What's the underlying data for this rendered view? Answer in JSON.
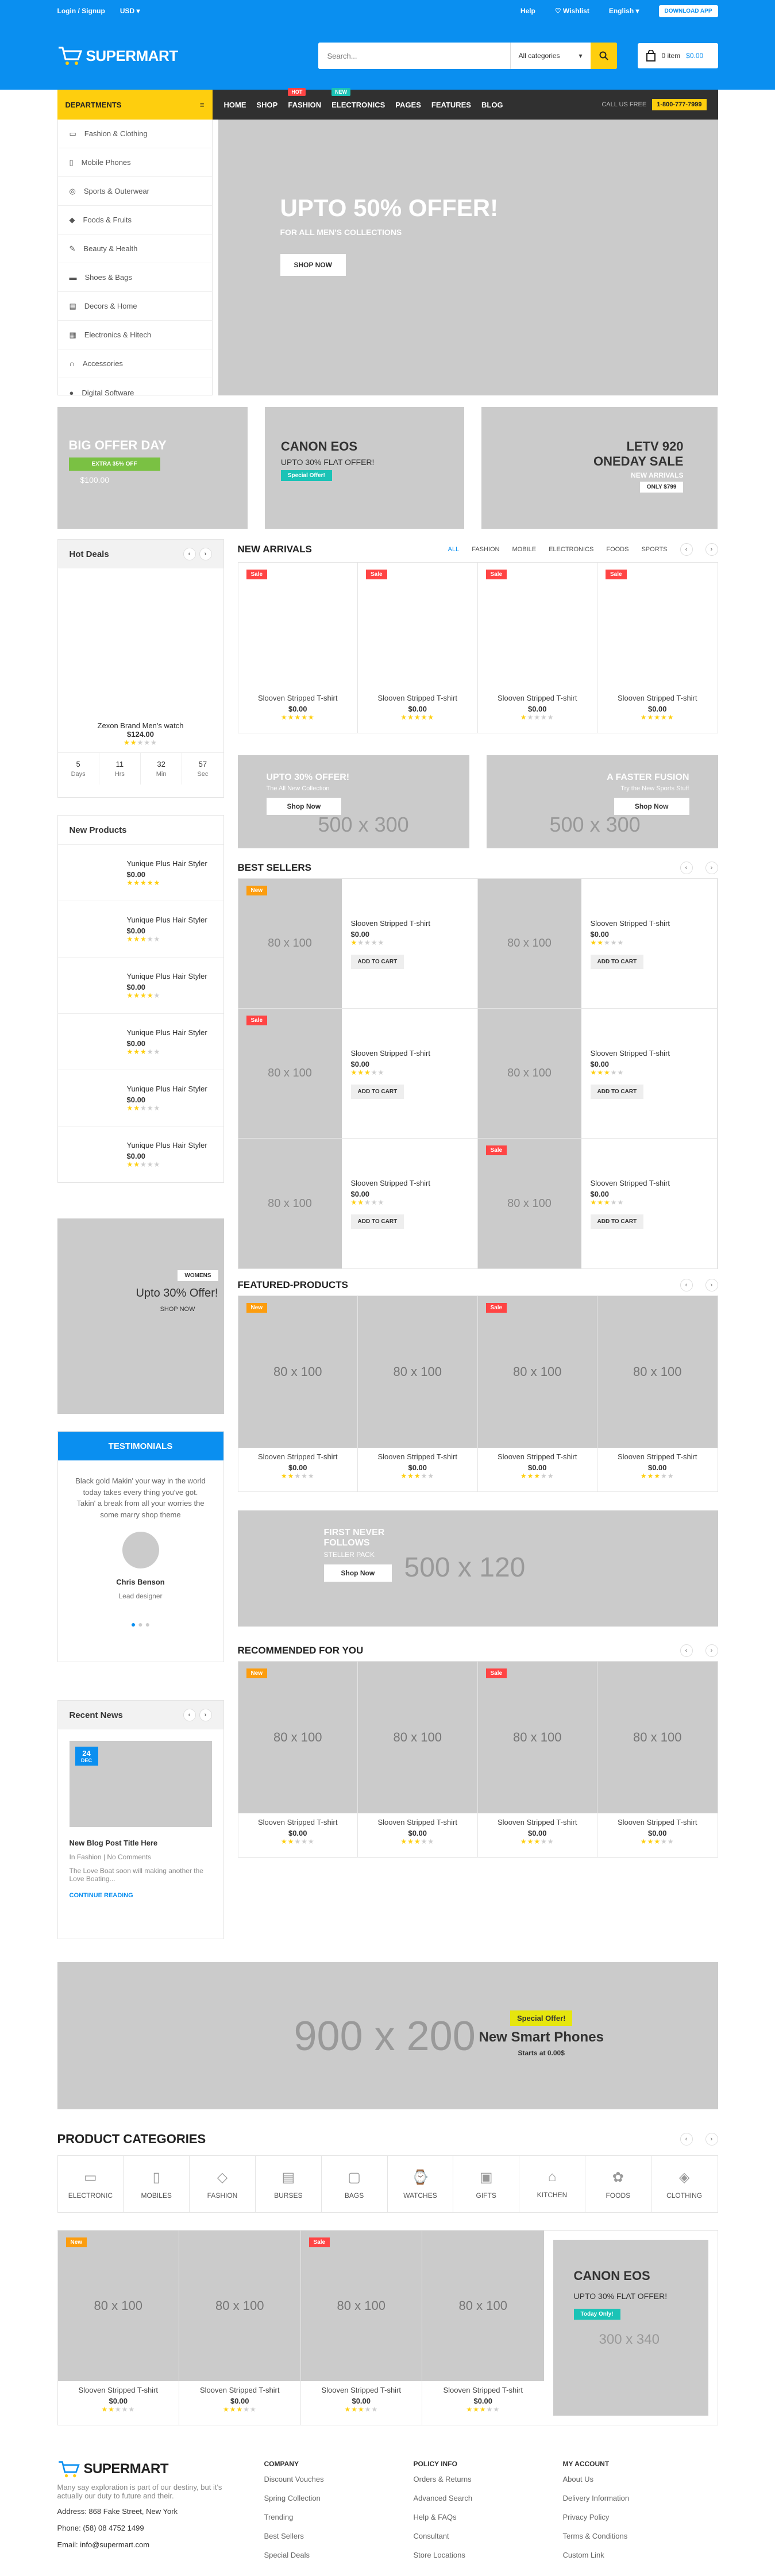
{
  "topbar": {
    "login": "Login / Signup",
    "currency": "USD",
    "help": "Help",
    "wishlist": "Wishlist",
    "language": "English",
    "download": "DOWNLOAD APP"
  },
  "header": {
    "logo": "SUPERMART",
    "search_placeholder": "Search...",
    "category": "All categories",
    "cart_label": "0 item",
    "cart_total": "$0.00"
  },
  "nav": {
    "departments": "DEPARTMENTS",
    "items": [
      "HOME",
      "SHOP",
      "FASHION",
      "ELECTRONICS",
      "PAGES",
      "FEATURES",
      "BLOG"
    ],
    "hot": "HOT",
    "new": "NEW",
    "callus": "CALL US FREE",
    "phone": "1-800-777-7999"
  },
  "sidebar": [
    "Fashion & Clothing",
    "Mobile Phones",
    "Sports & Outerwear",
    "Foods & Fruits",
    "Beauty & Health",
    "Shoes & Bags",
    "Decors & Home",
    "Electronics & Hitech",
    "Accessories",
    "Digital Software"
  ],
  "hero": {
    "title": "UPTO 50% OFFER!",
    "subtitle": "FOR ALL MEN'S COLLECTIONS",
    "button": "SHOP NOW"
  },
  "promos": {
    "p1": {
      "title": "BIG OFFER DAY",
      "tag": "EXTRA 35% OFF",
      "price": "$100.00"
    },
    "p2": {
      "title": "CANON EOS",
      "sub": "UPTO 30% FLAT OFFER!",
      "tag": "Special Offer!"
    },
    "p3": {
      "title": "LETV 920",
      "sub": "ONEDAY SALE",
      "sub2": "NEW ARRIVALS",
      "tag": "ONLY $799"
    }
  },
  "hotdeals": {
    "title": "Hot Deals",
    "name": "Zexon Brand Men's watch",
    "price": "$124.00",
    "counter": [
      {
        "v": "5",
        "l": "Days"
      },
      {
        "v": "11",
        "l": "Hrs"
      },
      {
        "v": "32",
        "l": "Min"
      },
      {
        "v": "57",
        "l": "Sec"
      }
    ]
  },
  "arrivals": {
    "title": "NEW ARRIVALS",
    "tabs": [
      "ALL",
      "FASHION",
      "MOBILE",
      "ELECTRONICS",
      "FOODS",
      "SPORTS"
    ],
    "name": "Slooven Stripped T-shirt",
    "price": "$0.00",
    "sale": "Sale"
  },
  "newproducts": {
    "title": "New Products",
    "name": "Yunique Plus Hair Styler",
    "price": "$0.00"
  },
  "midbanners": {
    "b1": {
      "title": "UPTO 30% OFFER!",
      "sub": "The All New Collection",
      "ph": "500 x 300",
      "button": "Shop Now"
    },
    "b2": {
      "title": "A FASTER FUSION",
      "sub": "Try the New Sports Stuff",
      "ph": "500 x 300",
      "button": "Shop Now"
    }
  },
  "bestsellers": {
    "title": "BEST SELLERS",
    "ph": "80 x 100",
    "name": "Slooven Stripped T-shirt",
    "price": "$0.00",
    "button": "ADD TO CART",
    "new": "New",
    "sale": "Sale"
  },
  "womens": {
    "tag": "WOMENS",
    "title": "Upto 30% Offer!",
    "shop": "SHOP NOW"
  },
  "testimonials": {
    "title": "TESTIMONIALS",
    "text": "Black gold Makin' your way in the world today takes every thing you've got. Takin' a break from all your worries the some marry shop theme",
    "name": "Chris Benson",
    "role": "Lead designer"
  },
  "featured": {
    "title": "FEATURED-PRODUCTS",
    "ph": "80 x 100"
  },
  "wide": {
    "title": "FIRST NEVER FOLLOWS",
    "sub": "STELLER PACK",
    "button": "Shop Now",
    "ph": "500 x 120"
  },
  "recommended": {
    "title": "RECOMMENDED FOR YOU"
  },
  "news": {
    "title": "Recent News",
    "day": "24",
    "month": "DEC",
    "post": "New Blog Post Title Here",
    "meta": "In Fashion | No Comments",
    "excerpt": "The Love Boat soon will making another the Love Boating...",
    "more": "CONTINUE READING"
  },
  "bigbanner": {
    "ph": "900 x 200",
    "tag": "Special Offer!",
    "title": "New Smart Phones",
    "sub": "Starts at 0.00$"
  },
  "categories": {
    "title": "PRODUCT CATEGORIES",
    "items": [
      "ELECTRONIC",
      "MOBILES",
      "FASHION",
      "BURSES",
      "BAGS",
      "WATCHES",
      "GIFTS",
      "KITCHEN",
      "FOODS",
      "CLOTHING"
    ]
  },
  "canon": {
    "title": "CANON EOS",
    "sub": "UPTO 30% FLAT OFFER!",
    "tag": "Today Only!",
    "ph": "300 x 340"
  },
  "footer": {
    "about": "Many say exploration is part of our destiny, but it's actually our duty to future and their.",
    "address": "Address: 868 Fake Street, New York",
    "phone": "Phone: (58) 08 4752 1499",
    "email": "Email: info@supermart.com",
    "cols": [
      {
        "h": "COMPANY",
        "items": [
          "Discount Vouches",
          "Spring Collection",
          "Trending",
          "Best Sellers",
          "Special Deals"
        ]
      },
      {
        "h": "POLICY INFO",
        "items": [
          "Orders & Returns",
          "Advanced Search",
          "Help & FAQs",
          "Consultant",
          "Store Locations"
        ]
      },
      {
        "h": "MY ACCOUNT",
        "items": [
          "About Us",
          "Delivery Information",
          "Privacy Policy",
          "Terms & Conditions",
          "Custom Link"
        ]
      }
    ]
  },
  "colors": {
    "primary": "#0a8ff0",
    "accent": "#fece0e",
    "dark": "#303030",
    "sale": "#f44444"
  }
}
